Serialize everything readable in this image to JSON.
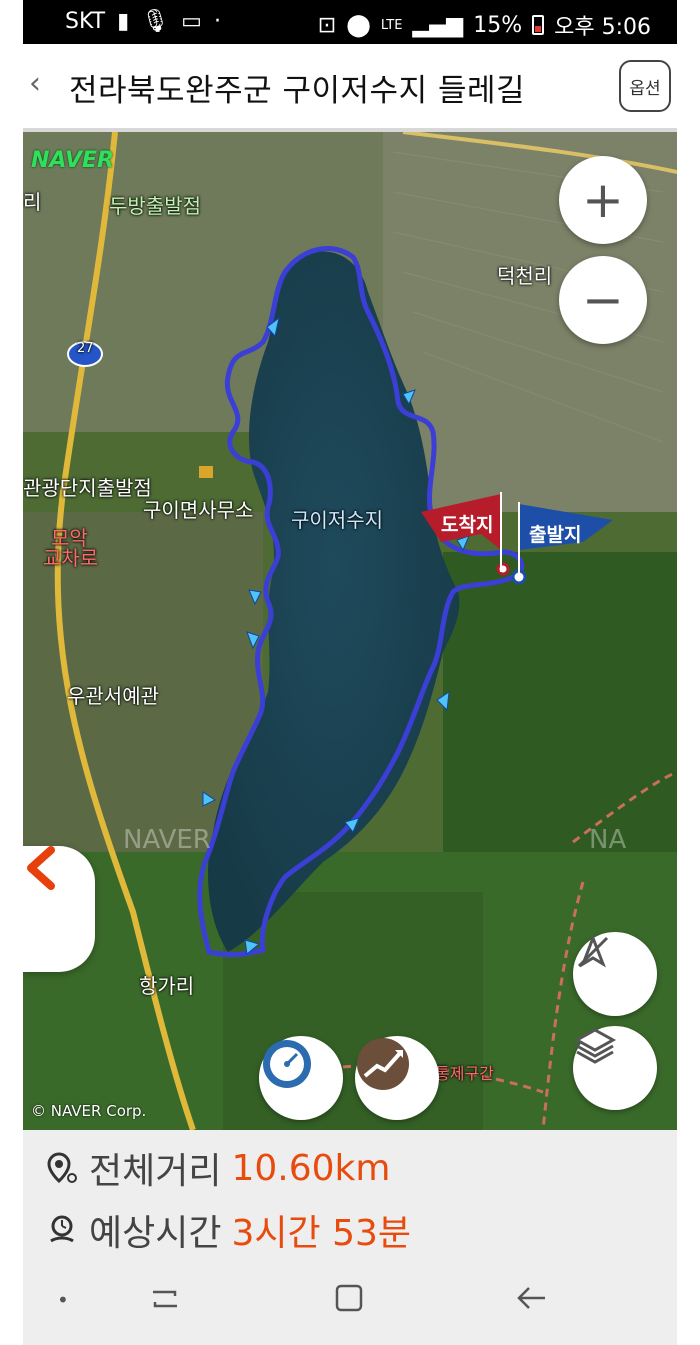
{
  "status_bar": {
    "carrier": "SKT",
    "network": "LTE",
    "battery": "15%",
    "time": "오후 5:06"
  },
  "header": {
    "title": "전라북도완주군 구이저수지 들레길",
    "option_label": "옵션"
  },
  "map": {
    "provider_logo": "NAVER",
    "labels": {
      "dubang": "두방출발점",
      "ri": "리",
      "deokcheon": "덕천리",
      "industrial": "관광단지출발점",
      "office": "구이면사무소",
      "reservoir": "구이저수지",
      "moak": "모악",
      "intersection": "교차로",
      "ugwan": "우관서예관",
      "hangga": "항가리",
      "tongje": "통제구간",
      "route_no": "27"
    },
    "flags": {
      "arrival": "도착지",
      "departure": "출발지"
    },
    "copyright": "© NAVER Corp."
  },
  "route_info": {
    "distance_label": "전체거리",
    "distance_value": "10.60km",
    "time_label": "예상시간",
    "time_value": "3시간 53분"
  },
  "colors": {
    "route": "#3b3fd6",
    "accent": "#e74c0e",
    "arrival_flag": "#b71c2b",
    "departure_flag": "#1e4fa8"
  }
}
